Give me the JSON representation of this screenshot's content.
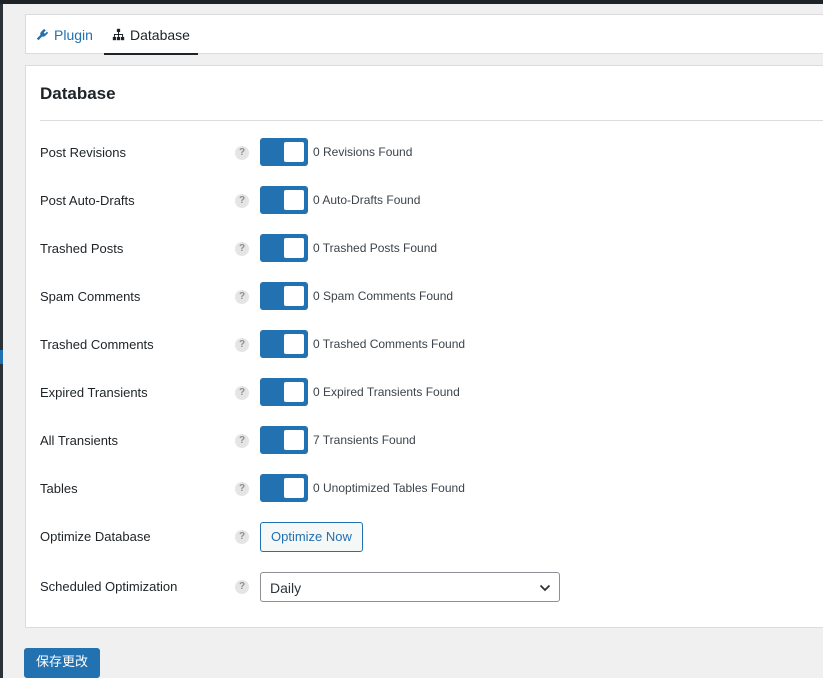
{
  "tabs": [
    {
      "label": "Plugin",
      "icon": "plug-icon",
      "active": false
    },
    {
      "label": "Database",
      "icon": "sitemap-icon",
      "active": true
    }
  ],
  "panel": {
    "title": "Database",
    "rows": [
      {
        "label": "Post Revisions",
        "toggle": true,
        "status": "0 Revisions Found"
      },
      {
        "label": "Post Auto-Drafts",
        "toggle": true,
        "status": "0 Auto-Drafts Found"
      },
      {
        "label": "Trashed Posts",
        "toggle": true,
        "status": "0 Trashed Posts Found"
      },
      {
        "label": "Spam Comments",
        "toggle": true,
        "status": "0 Spam Comments Found"
      },
      {
        "label": "Trashed Comments",
        "toggle": true,
        "status": "0 Trashed Comments Found"
      },
      {
        "label": "Expired Transients",
        "toggle": true,
        "status": "0 Expired Transients Found"
      },
      {
        "label": "All Transients",
        "toggle": true,
        "status": "7 Transients Found"
      },
      {
        "label": "Tables",
        "toggle": true,
        "status": "0 Unoptimized Tables Found"
      }
    ],
    "optimize": {
      "label": "Optimize Database",
      "button": "Optimize Now"
    },
    "schedule": {
      "label": "Scheduled Optimization",
      "value": "Daily"
    }
  },
  "help_glyph": "?",
  "save_button": "保存更改",
  "colors": {
    "accent": "#2271b1",
    "background": "#f0f0f1",
    "panel": "#ffffff",
    "border": "#dcdcde"
  }
}
